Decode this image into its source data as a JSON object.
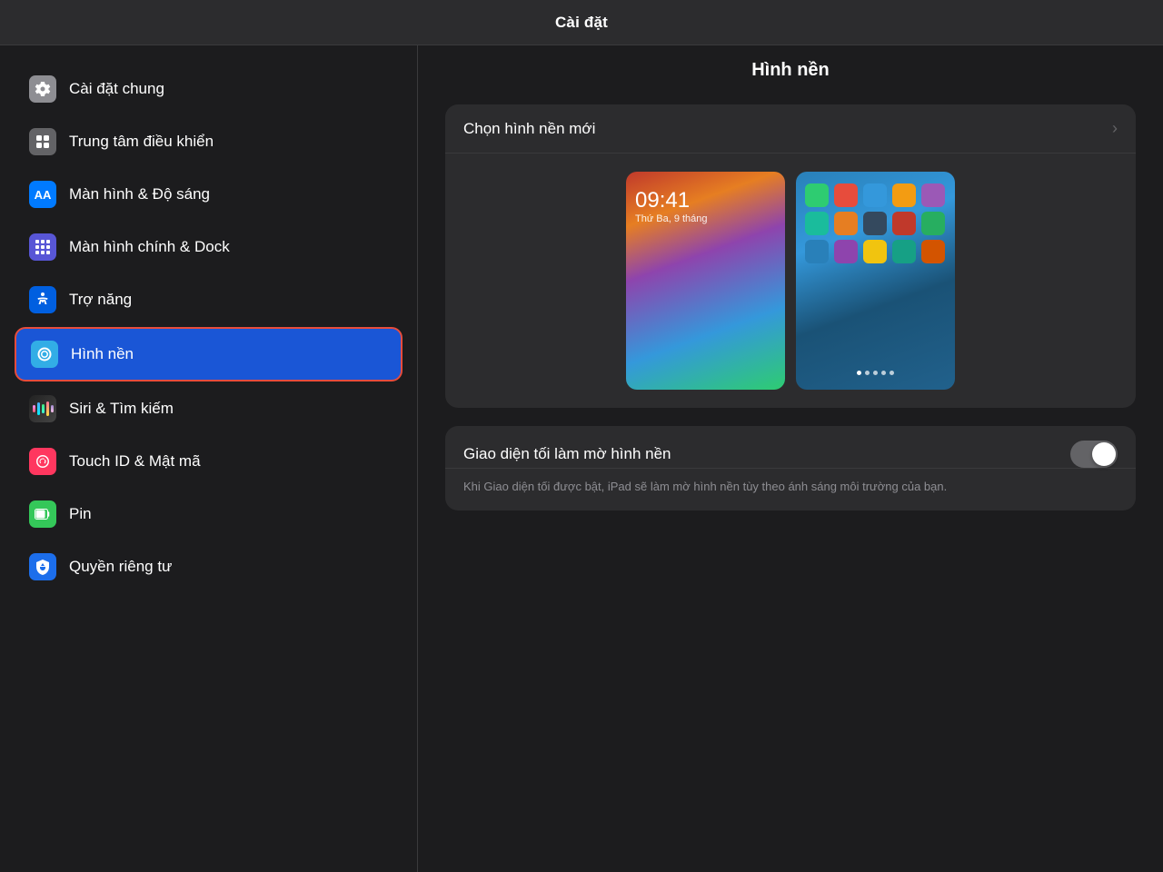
{
  "header": {
    "title": "Cài đặt"
  },
  "sidebar": {
    "items": [
      {
        "id": "cai-dat-chung",
        "label": "Cài đặt chung",
        "iconClass": "icon-gray",
        "iconSymbol": "⚙️",
        "active": false
      },
      {
        "id": "trung-tam-dieu-khien",
        "label": "Trung tâm điều khiển",
        "iconClass": "icon-dark-gray",
        "iconSymbol": "⊞",
        "active": false
      },
      {
        "id": "man-hinh-do-sang",
        "label": "Màn hình & Độ sáng",
        "iconClass": "icon-blue",
        "iconSymbol": "AA",
        "active": false
      },
      {
        "id": "man-hinh-chinh-dock",
        "label": "Màn hình chính & Dock",
        "iconClass": "icon-purple",
        "iconSymbol": "⊞",
        "active": false
      },
      {
        "id": "tro-nang",
        "label": "Trợ năng",
        "iconClass": "icon-accessibility",
        "iconSymbol": "♿",
        "active": false
      },
      {
        "id": "hinh-nen",
        "label": "Hình nền",
        "iconClass": "icon-wallpaper",
        "iconSymbol": "❋",
        "active": true
      },
      {
        "id": "siri-tim-kiem",
        "label": "Siri & Tìm kiếm",
        "iconClass": "icon-siri",
        "iconSymbol": "🔊",
        "active": false
      },
      {
        "id": "touch-id",
        "label": "Touch ID & Mật mã",
        "iconClass": "icon-touchid",
        "iconSymbol": "👆",
        "active": false
      },
      {
        "id": "pin",
        "label": "Pin",
        "iconClass": "icon-battery",
        "iconSymbol": "🔋",
        "active": false
      },
      {
        "id": "quyen-rieng-tu",
        "label": "Quyền riêng tư",
        "iconClass": "icon-privacy",
        "iconSymbol": "✋",
        "active": false
      }
    ]
  },
  "detail": {
    "title": "Hình nền",
    "choose_wallpaper_label": "Chọn hình nền mới",
    "toggle_label": "Giao diện tối làm mờ hình nền",
    "toggle_description": "Khi Giao diện tối được bật, iPad sẽ làm mờ hình nền tùy theo ánh sáng môi trường của bạn.",
    "lock_time": "09:41",
    "lock_date": "Thứ Ba, 9 tháng",
    "toggle_enabled": false
  },
  "icons": {
    "chevron": "›",
    "gear": "⚙",
    "shield": "⊡"
  }
}
